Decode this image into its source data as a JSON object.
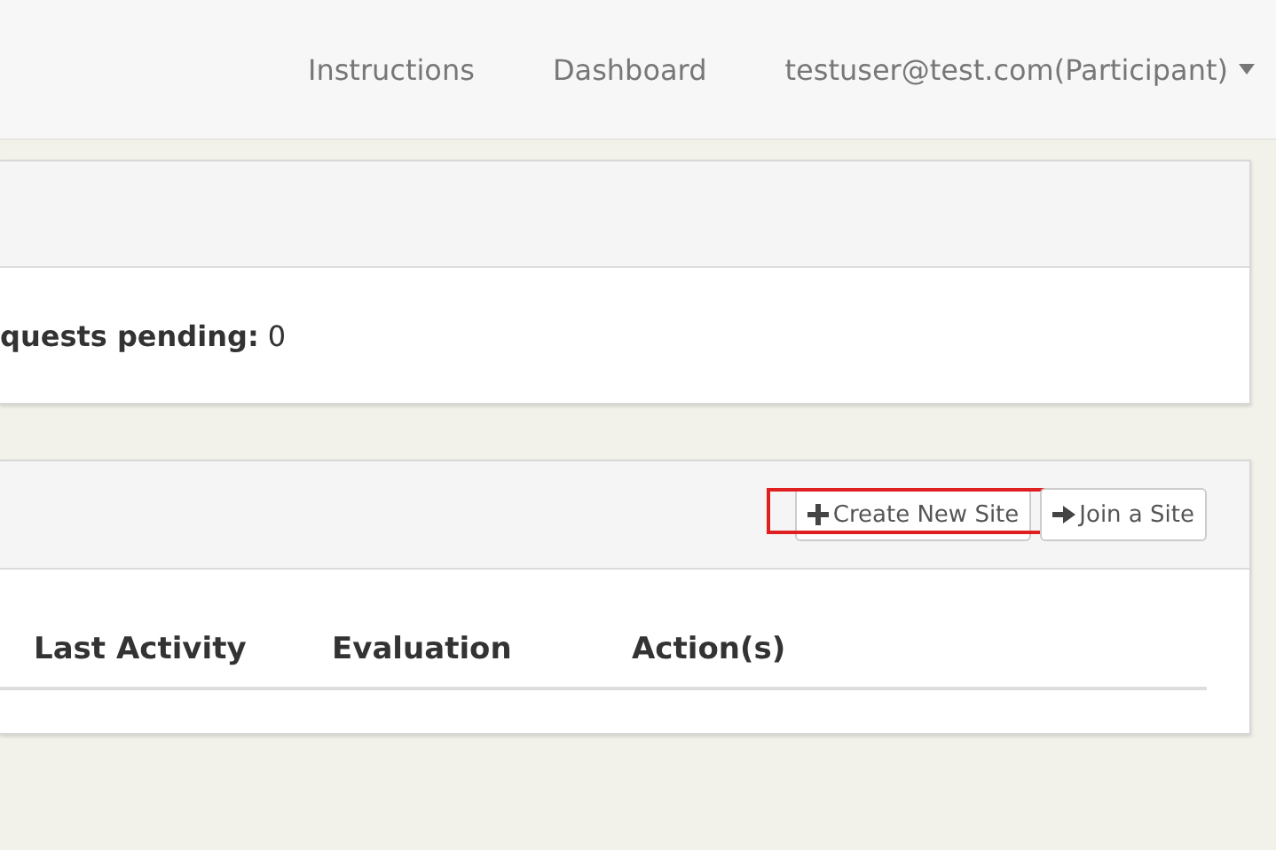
{
  "navbar": {
    "links": [
      "Instructions",
      "Dashboard"
    ],
    "user_menu": "testuser@test.com(Participant)"
  },
  "requests_panel": {
    "text": "**quests pending:** 0"
  },
  "sites_panel": {
    "buttons": [
      {
        "kind": "create",
        "label": "Create New Site",
        "highlighted": true
      },
      {
        "kind": "join",
        "label": "Join a Site",
        "highlighted": false
      }
    ],
    "columns": [
      "Last Activity",
      "Evaluation",
      "Action(s)"
    ]
  }
}
